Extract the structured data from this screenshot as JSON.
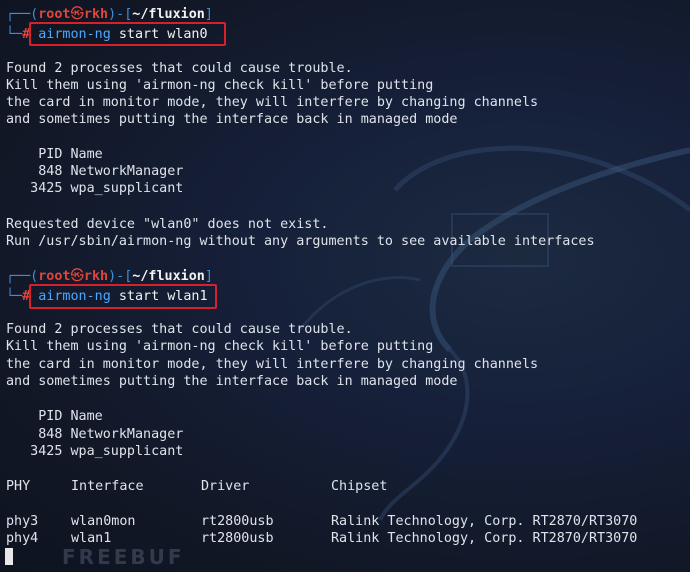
{
  "prompt": {
    "user": "root",
    "host": "rkh",
    "skull": "㉿",
    "path": "~/fluxion",
    "hash": "#"
  },
  "blocks": [
    {
      "command_name": "airmon-ng",
      "command_args": " start wlan0",
      "output": [
        "Found 2 processes that could cause trouble.",
        "Kill them using 'airmon-ng check kill' before putting",
        "the card in monitor mode, they will interfere by changing channels",
        "and sometimes putting the interface back in managed mode",
        "",
        "    PID Name",
        "    848 NetworkManager",
        "   3425 wpa_supplicant",
        "",
        "Requested device \"wlan0\" does not exist.",
        "Run /usr/sbin/airmon-ng without any arguments to see available interfaces"
      ]
    },
    {
      "command_name": "airmon-ng",
      "command_args": " start wlan1",
      "output": [
        "Found 2 processes that could cause trouble.",
        "Kill them using 'airmon-ng check kill' before putting",
        "the card in monitor mode, they will interfere by changing channels",
        "and sometimes putting the interface back in managed mode",
        "",
        "    PID Name",
        "    848 NetworkManager",
        "   3425 wpa_supplicant"
      ]
    }
  ],
  "table": {
    "headers": [
      "PHY",
      "Interface",
      "Driver",
      "Chipset"
    ],
    "rows": [
      [
        "phy3",
        "wlan0mon",
        "rt2800usb",
        "Ralink Technology, Corp. RT2870/RT3070"
      ],
      [
        "phy4",
        "wlan1",
        "rt2800usb",
        "Ralink Technology, Corp. RT2870/RT3070"
      ]
    ]
  },
  "watermark": "FREEBUF",
  "colors": {
    "background": "#141a2b",
    "prompt_bracket": "#3f8fd8",
    "prompt_user": "#e0453a",
    "command": "#4aa8ff",
    "highlight_box": "#d8202a"
  }
}
